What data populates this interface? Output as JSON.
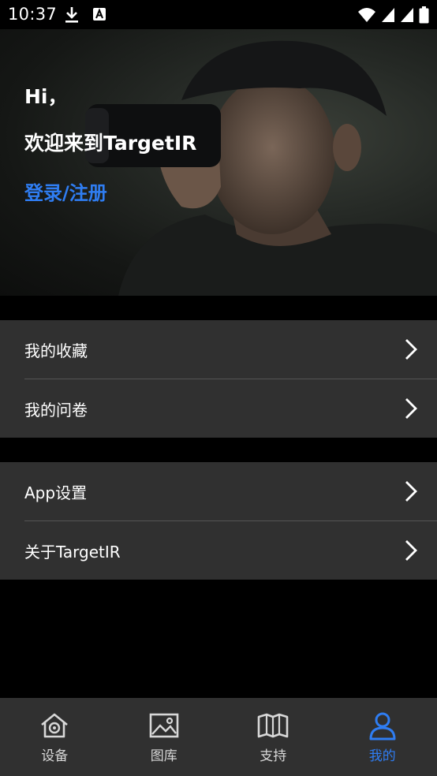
{
  "status_bar": {
    "time": "10:37",
    "icons": [
      "download-icon",
      "notification-a-icon",
      "wifi-icon",
      "signal-icon",
      "signal-icon",
      "battery-icon"
    ]
  },
  "hero": {
    "greeting": "Hi，",
    "welcome": "欢迎来到TargetIR",
    "login_link": "登录/注册"
  },
  "menu_group_1": [
    {
      "label": "我的收藏",
      "icon": "chevron-right-icon"
    },
    {
      "label": "我的问卷",
      "icon": "chevron-right-icon"
    }
  ],
  "menu_group_2": [
    {
      "label": "App设置",
      "icon": "chevron-right-icon"
    },
    {
      "label": "关于TargetIR",
      "icon": "chevron-right-icon"
    }
  ],
  "tab_bar": {
    "tabs": [
      {
        "label": "设备",
        "icon": "home-device-icon",
        "active": false
      },
      {
        "label": "图库",
        "icon": "gallery-icon",
        "active": false
      },
      {
        "label": "支持",
        "icon": "book-icon",
        "active": false
      },
      {
        "label": "我的",
        "icon": "person-icon",
        "active": true
      }
    ]
  },
  "colors": {
    "accent": "#2f7df2",
    "panel": "#303030",
    "background": "#000000"
  }
}
